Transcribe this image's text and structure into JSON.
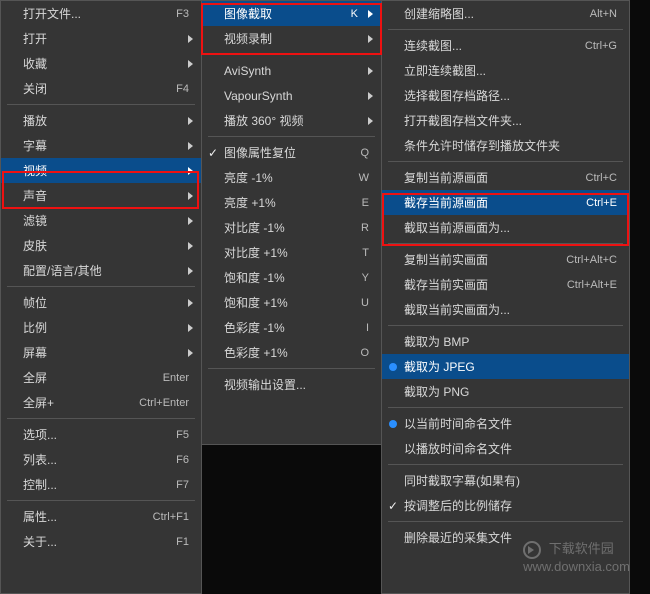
{
  "col1": {
    "groups": [
      [
        {
          "label": "打开文件...",
          "shortcut": "F3",
          "arrow": false
        },
        {
          "label": "打开",
          "shortcut": "",
          "arrow": true
        },
        {
          "label": "收藏",
          "shortcut": "",
          "arrow": true
        },
        {
          "label": "关闭",
          "shortcut": "F4",
          "arrow": false
        }
      ],
      [
        {
          "label": "播放",
          "shortcut": "",
          "arrow": true
        },
        {
          "label": "字幕",
          "shortcut": "",
          "arrow": true
        },
        {
          "label": "视频",
          "shortcut": "",
          "arrow": true,
          "hover": true
        },
        {
          "label": "声音",
          "shortcut": "",
          "arrow": true
        },
        {
          "label": "滤镜",
          "shortcut": "",
          "arrow": true
        },
        {
          "label": "皮肤",
          "shortcut": "",
          "arrow": true
        },
        {
          "label": "配置/语言/其他",
          "shortcut": "",
          "arrow": true
        }
      ],
      [
        {
          "label": "帧位",
          "shortcut": "",
          "arrow": true
        },
        {
          "label": "比例",
          "shortcut": "",
          "arrow": true
        },
        {
          "label": "屏幕",
          "shortcut": "",
          "arrow": true
        },
        {
          "label": "全屏",
          "shortcut": "Enter",
          "arrow": false
        },
        {
          "label": "全屏+",
          "shortcut": "Ctrl+Enter",
          "arrow": false
        }
      ],
      [
        {
          "label": "选项...",
          "shortcut": "F5",
          "arrow": false
        },
        {
          "label": "列表...",
          "shortcut": "F6",
          "arrow": false
        },
        {
          "label": "控制...",
          "shortcut": "F7",
          "arrow": false
        }
      ],
      [
        {
          "label": "属性...",
          "shortcut": "Ctrl+F1",
          "arrow": false
        },
        {
          "label": "关于...",
          "shortcut": "F1",
          "arrow": false
        }
      ]
    ]
  },
  "col2": {
    "groups": [
      [
        {
          "label": "图像截取",
          "shortcut": "K",
          "arrow": true,
          "hover": true
        },
        {
          "label": "视频录制",
          "shortcut": "",
          "arrow": true
        }
      ],
      [
        {
          "label": "AviSynth",
          "shortcut": "",
          "arrow": true
        },
        {
          "label": "VapourSynth",
          "shortcut": "",
          "arrow": true
        },
        {
          "label": "播放 360° 视频",
          "shortcut": "",
          "arrow": true
        }
      ],
      [
        {
          "label": "图像属性复位",
          "shortcut": "Q",
          "check": true
        },
        {
          "label": "亮度 -1%",
          "shortcut": "W"
        },
        {
          "label": "亮度 +1%",
          "shortcut": "E"
        },
        {
          "label": "对比度 -1%",
          "shortcut": "R"
        },
        {
          "label": "对比度 +1%",
          "shortcut": "T"
        },
        {
          "label": "饱和度 -1%",
          "shortcut": "Y"
        },
        {
          "label": "饱和度 +1%",
          "shortcut": "U"
        },
        {
          "label": "色彩度 -1%",
          "shortcut": "I"
        },
        {
          "label": "色彩度 +1%",
          "shortcut": "O"
        }
      ],
      [
        {
          "label": "视频输出设置...",
          "shortcut": ""
        }
      ]
    ]
  },
  "col3": {
    "groups": [
      [
        {
          "label": "创建缩略图...",
          "shortcut": "Alt+N"
        }
      ],
      [
        {
          "label": "连续截图...",
          "shortcut": "Ctrl+G"
        },
        {
          "label": "立即连续截图..."
        },
        {
          "label": "选择截图存档路径..."
        },
        {
          "label": "打开截图存档文件夹..."
        },
        {
          "label": "条件允许时储存到播放文件夹"
        }
      ],
      [
        {
          "label": "复制当前源画面",
          "shortcut": "Ctrl+C"
        },
        {
          "label": "截存当前源画面",
          "shortcut": "Ctrl+E",
          "hover": true
        },
        {
          "label": "截取当前源画面为..."
        }
      ],
      [
        {
          "label": "复制当前实画面",
          "shortcut": "Ctrl+Alt+C"
        },
        {
          "label": "截存当前实画面",
          "shortcut": "Ctrl+Alt+E"
        },
        {
          "label": "截取当前实画面为..."
        }
      ],
      [
        {
          "label": "截取为 BMP"
        },
        {
          "label": "截取为 JPEG",
          "radio": true,
          "hover": true
        },
        {
          "label": "截取为 PNG"
        }
      ],
      [
        {
          "label": "以当前时间命名文件",
          "radio": true
        },
        {
          "label": "以播放时间命名文件"
        }
      ],
      [
        {
          "label": "同时截取字幕(如果有)"
        },
        {
          "label": "按调整后的比例储存",
          "check": true
        }
      ],
      [
        {
          "label": "删除最近的采集文件"
        }
      ]
    ]
  },
  "watermark": {
    "site": "www.downxia.com",
    "brand": "下载软件园"
  }
}
